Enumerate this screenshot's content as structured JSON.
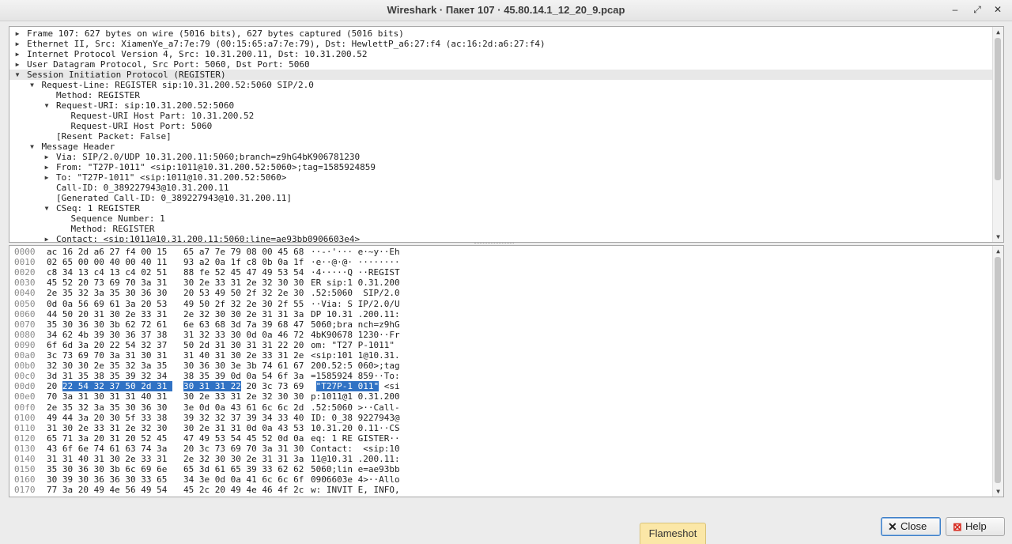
{
  "window": {
    "title": "Wireshark · Пакет 107 · 45.80.14.1_12_20_9.pcap",
    "minimize_glyph": "–",
    "restore_glyph": "⤢",
    "close_glyph": "✕"
  },
  "tree": [
    {
      "depth": 0,
      "arrow": "right",
      "text": "Frame 107: 627 bytes on wire (5016 bits), 627 bytes captured (5016 bits)"
    },
    {
      "depth": 0,
      "arrow": "right",
      "text": "Ethernet II, Src: XiamenYe_a7:7e:79 (00:15:65:a7:7e:79), Dst: HewlettP_a6:27:f4 (ac:16:2d:a6:27:f4)"
    },
    {
      "depth": 0,
      "arrow": "right",
      "text": "Internet Protocol Version 4, Src: 10.31.200.11, Dst: 10.31.200.52"
    },
    {
      "depth": 0,
      "arrow": "right",
      "text": "User Datagram Protocol, Src Port: 5060, Dst Port: 5060"
    },
    {
      "depth": 0,
      "arrow": "down",
      "text": "Session Initiation Protocol (REGISTER)",
      "selected": true
    },
    {
      "depth": 1,
      "arrow": "down",
      "text": "Request-Line: REGISTER sip:10.31.200.52:5060 SIP/2.0"
    },
    {
      "depth": 2,
      "arrow": "",
      "text": "Method: REGISTER"
    },
    {
      "depth": 2,
      "arrow": "down",
      "text": "Request-URI: sip:10.31.200.52:5060"
    },
    {
      "depth": 3,
      "arrow": "",
      "text": "Request-URI Host Part: 10.31.200.52"
    },
    {
      "depth": 3,
      "arrow": "",
      "text": "Request-URI Host Port: 5060"
    },
    {
      "depth": 2,
      "arrow": "",
      "text": "[Resent Packet: False]"
    },
    {
      "depth": 1,
      "arrow": "down",
      "text": "Message Header"
    },
    {
      "depth": 2,
      "arrow": "right",
      "text": "Via: SIP/2.0/UDP 10.31.200.11:5060;branch=z9hG4bK906781230"
    },
    {
      "depth": 2,
      "arrow": "right",
      "text": "From: \"T27P-1011\" <sip:1011@10.31.200.52:5060>;tag=1585924859"
    },
    {
      "depth": 2,
      "arrow": "right",
      "text": "To: \"T27P-1011\" <sip:1011@10.31.200.52:5060>"
    },
    {
      "depth": 2,
      "arrow": "",
      "text": "Call-ID: 0_389227943@10.31.200.11"
    },
    {
      "depth": 2,
      "arrow": "",
      "text": "[Generated Call-ID: 0_389227943@10.31.200.11]"
    },
    {
      "depth": 2,
      "arrow": "down",
      "text": "CSeq: 1 REGISTER"
    },
    {
      "depth": 3,
      "arrow": "",
      "text": "Sequence Number: 1"
    },
    {
      "depth": 3,
      "arrow": "",
      "text": "Method: REGISTER"
    },
    {
      "depth": 2,
      "arrow": "right",
      "text": "Contact: <sip:1011@10.31.200.11:5060;line=ae93bb0906603e4>"
    }
  ],
  "hex": [
    {
      "off": "0000",
      "a": "ac 16 2d a6 27 f4 00 15",
      "b": "65 a7 7e 79 08 00 45 68",
      "asc": "··-·'··· e·~y··Eh"
    },
    {
      "off": "0010",
      "a": "02 65 00 00 40 00 40 11",
      "b": "93 a2 0a 1f c8 0b 0a 1f",
      "asc": "·e··@·@· ········"
    },
    {
      "off": "0020",
      "a": "c8 34 13 c4 13 c4 02 51",
      "b": "88 fe 52 45 47 49 53 54",
      "asc": "·4·····Q ··REGIST"
    },
    {
      "off": "0030",
      "a": "45 52 20 73 69 70 3a 31",
      "b": "30 2e 33 31 2e 32 30 30",
      "asc": "ER sip:1 0.31.200"
    },
    {
      "off": "0040",
      "a": "2e 35 32 3a 35 30 36 30",
      "b": "20 53 49 50 2f 32 2e 30",
      "asc": ".52:5060  SIP/2.0"
    },
    {
      "off": "0050",
      "a": "0d 0a 56 69 61 3a 20 53",
      "b": "49 50 2f 32 2e 30 2f 55",
      "asc": "··Via: S IP/2.0/U"
    },
    {
      "off": "0060",
      "a": "44 50 20 31 30 2e 33 31",
      "b": "2e 32 30 30 2e 31 31 3a",
      "asc": "DP 10.31 .200.11:"
    },
    {
      "off": "0070",
      "a": "35 30 36 30 3b 62 72 61",
      "b": "6e 63 68 3d 7a 39 68 47",
      "asc": "5060;bra nch=z9hG"
    },
    {
      "off": "0080",
      "a": "34 62 4b 39 30 36 37 38",
      "b": "31 32 33 30 0d 0a 46 72",
      "asc": "4bK90678 1230··Fr"
    },
    {
      "off": "0090",
      "a": "6f 6d 3a 20 22 54 32 37",
      "b": "50 2d 31 30 31 31 22 20",
      "asc": "om: \"T27 P-1011\" "
    },
    {
      "off": "00a0",
      "a": "3c 73 69 70 3a 31 30 31",
      "b": "31 40 31 30 2e 33 31 2e",
      "asc": "<sip:101 1@10.31."
    },
    {
      "off": "00b0",
      "a": "32 30 30 2e 35 32 3a 35",
      "b": "30 36 30 3e 3b 74 61 67",
      "asc": "200.52:5 060>;tag"
    },
    {
      "off": "00c0",
      "a": "3d 31 35 38 35 39 32 34",
      "b": "38 35 39 0d 0a 54 6f 3a",
      "asc": "=1585924 859··To:"
    },
    {
      "off": "00d0",
      "a": "20 22 54 32 37 50 2d 31",
      "b": "30 31 31 22 20 3c 73 69",
      "asc": " \"T27P-1 011\" <si",
      "hl": true
    },
    {
      "off": "00e0",
      "a": "70 3a 31 30 31 31 40 31",
      "b": "30 2e 33 31 2e 32 30 30",
      "asc": "p:1011@1 0.31.200"
    },
    {
      "off": "00f0",
      "a": "2e 35 32 3a 35 30 36 30",
      "b": "3e 0d 0a 43 61 6c 6c 2d",
      "asc": ".52:5060 >··Call-"
    },
    {
      "off": "0100",
      "a": "49 44 3a 20 30 5f 33 38",
      "b": "39 32 32 37 39 34 33 40",
      "asc": "ID: 0_38 9227943@"
    },
    {
      "off": "0110",
      "a": "31 30 2e 33 31 2e 32 30",
      "b": "30 2e 31 31 0d 0a 43 53",
      "asc": "10.31.20 0.11··CS"
    },
    {
      "off": "0120",
      "a": "65 71 3a 20 31 20 52 45",
      "b": "47 49 53 54 45 52 0d 0a",
      "asc": "eq: 1 RE GISTER··"
    },
    {
      "off": "0130",
      "a": "43 6f 6e 74 61 63 74 3a",
      "b": "20 3c 73 69 70 3a 31 30",
      "asc": "Contact:  <sip:10"
    },
    {
      "off": "0140",
      "a": "31 31 40 31 30 2e 33 31",
      "b": "2e 32 30 30 2e 31 31 3a",
      "asc": "11@10.31 .200.11:"
    },
    {
      "off": "0150",
      "a": "35 30 36 30 3b 6c 69 6e",
      "b": "65 3d 61 65 39 33 62 62",
      "asc": "5060;lin e=ae93bb"
    },
    {
      "off": "0160",
      "a": "30 39 30 36 36 30 33 65",
      "b": "34 3e 0d 0a 41 6c 6c 6f",
      "asc": "0906603e 4>··Allo"
    },
    {
      "off": "0170",
      "a": "77 3a 20 49 4e 56 49 54",
      "b": "45 2c 20 49 4e 46 4f 2c",
      "asc": "w: INVIT E, INFO,"
    }
  ],
  "buttons": {
    "close_label": "Close",
    "help_label": "Help"
  },
  "taskbar": {
    "flameshot_label": "Flameshot"
  },
  "colors": {
    "selection": "#3072c4",
    "tree_selected_row": "#e8e8e8",
    "flameshot_bg": "#fbe7a7"
  }
}
